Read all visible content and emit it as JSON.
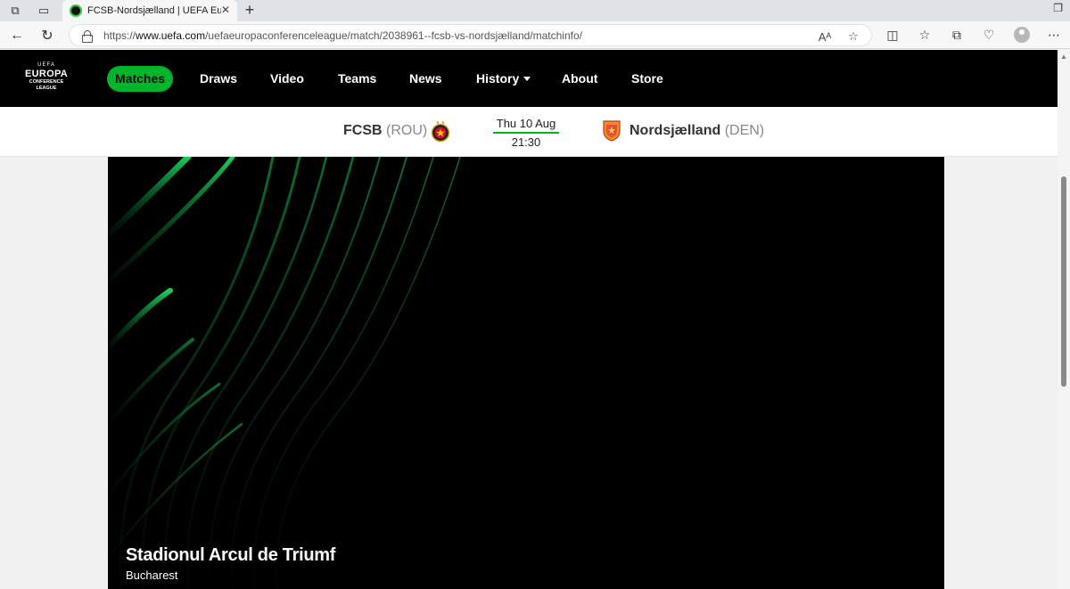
{
  "browser": {
    "tab_title": "FCSB-Nordsjælland | UEFA Europa Conference League",
    "url_scheme": "https://",
    "url_host": "www.uefa.com",
    "url_path": "/uefaeuropaconferenceleague/match/2038961--fcsb-vs-nordsjælland/matchinfo/"
  },
  "site": {
    "logo": {
      "line1": "UEFA",
      "line2": "EUROPA",
      "line3": "CONFERENCE",
      "line4": "LEAGUE"
    },
    "nav": {
      "matches": "Matches",
      "draws": "Draws",
      "video": "Video",
      "teams": "Teams",
      "news": "News",
      "history": "History",
      "about": "About",
      "store": "Store"
    },
    "accent_color": "#00b52a"
  },
  "match": {
    "home_team": "FCSB",
    "home_country": "(ROU)",
    "away_team": "Nordsjælland",
    "away_country": "(DEN)",
    "date": "Thu 10 Aug",
    "time": "21:30"
  },
  "venue": {
    "stadium": "Stadionul Arcul de Triumf",
    "city": "Bucharest"
  }
}
